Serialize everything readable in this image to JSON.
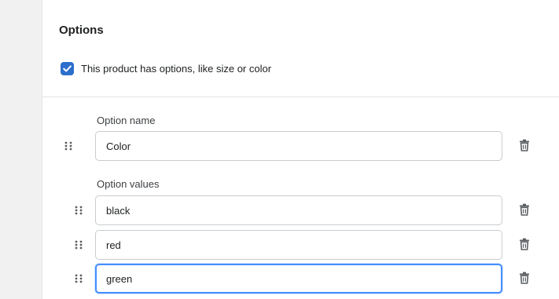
{
  "options": {
    "title": "Options",
    "has_options_label": "This product has options, like size or color",
    "has_options_checked": true,
    "option_name_label": "Option name",
    "option_name_value": "Color",
    "option_values_label": "Option values",
    "values": [
      "black",
      "red",
      "green"
    ],
    "focused_value_index": 2
  },
  "icons": {
    "drag": "drag-handle-icon",
    "delete": "trash-icon",
    "check": "checkmark-icon"
  },
  "colors": {
    "accent": "#2c6ecb",
    "focus_ring": "#458fff",
    "border": "#c9cccf",
    "icon": "#5c5f62"
  }
}
